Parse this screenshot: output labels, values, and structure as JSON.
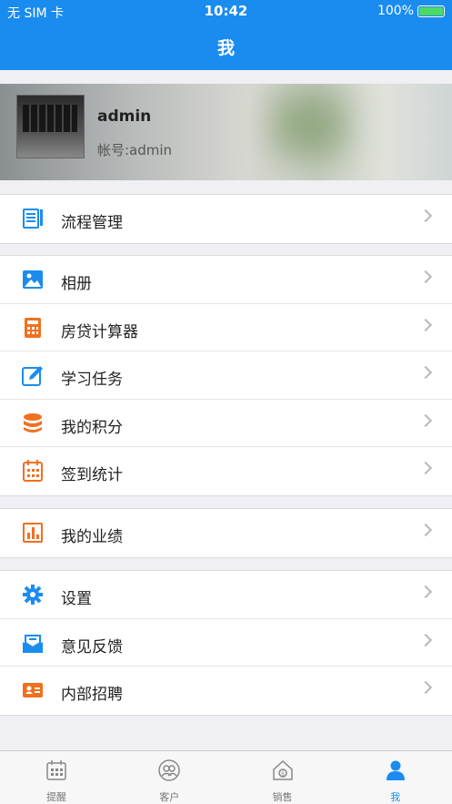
{
  "status_bar": {
    "carrier": "无 SIM 卡",
    "time": "10:42",
    "battery": "100%"
  },
  "header": {
    "title": "我"
  },
  "profile": {
    "name": "admin",
    "account": "帐号:admin"
  },
  "groups": [
    {
      "items": [
        {
          "label": "流程管理",
          "icon": "document-list-icon",
          "color": "#1a8cf0"
        }
      ]
    },
    {
      "items": [
        {
          "label": "相册",
          "icon": "image-icon",
          "color": "#1a8cf0"
        },
        {
          "label": "房贷计算器",
          "icon": "calculator-icon",
          "color": "#f07020"
        },
        {
          "label": "学习任务",
          "icon": "pencil-icon",
          "color": "#1a8cf0"
        },
        {
          "label": "我的积分",
          "icon": "coins-icon",
          "color": "#f07020"
        },
        {
          "label": "签到统计",
          "icon": "calendar-icon",
          "color": "#f07020"
        }
      ]
    },
    {
      "items": [
        {
          "label": "我的业绩",
          "icon": "bar-chart-icon",
          "color": "#f07020"
        }
      ]
    },
    {
      "items": [
        {
          "label": "设置",
          "icon": "gear-icon",
          "color": "#1a8cf0"
        },
        {
          "label": "意见反馈",
          "icon": "mail-icon",
          "color": "#1a8cf0"
        },
        {
          "label": "内部招聘",
          "icon": "id-card-icon",
          "color": "#f07020"
        }
      ]
    }
  ],
  "tabs": [
    {
      "label": "提醒",
      "icon": "calendar-tab-icon",
      "active": false
    },
    {
      "label": "客户",
      "icon": "customers-icon",
      "active": false
    },
    {
      "label": "销售",
      "icon": "sales-house-icon",
      "active": false
    },
    {
      "label": "我",
      "icon": "person-icon",
      "active": true
    }
  ]
}
